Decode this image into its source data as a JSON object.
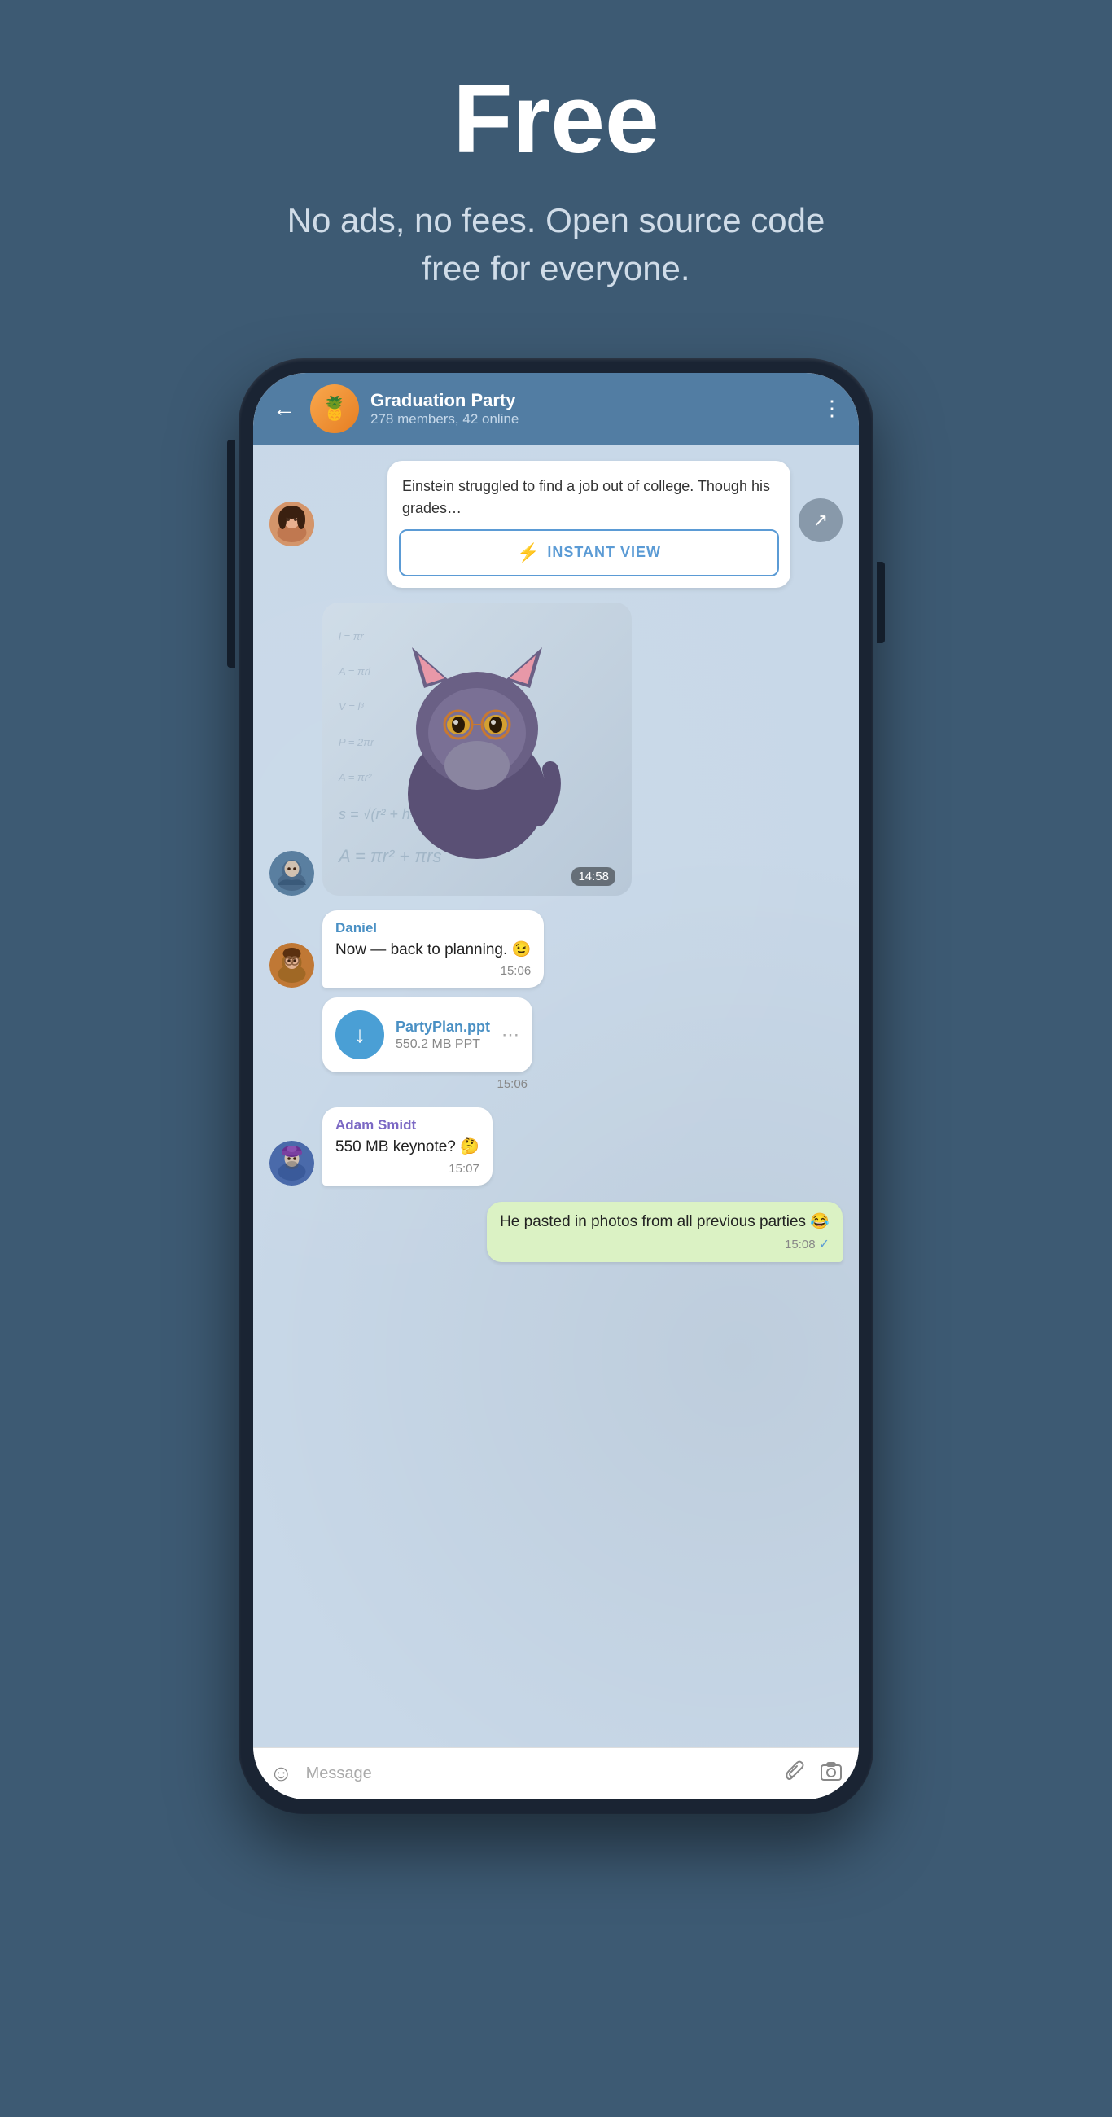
{
  "page": {
    "title": "Free",
    "subtitle": "No ads, no fees. Open source code free for everyone."
  },
  "chat": {
    "name": "Graduation Party",
    "status": "278 members, 42 online",
    "avatar_emoji": "🍍"
  },
  "messages": [
    {
      "id": "article",
      "type": "article",
      "text": "Einstein struggled to find a job out of college. Though his grades...",
      "instant_view_label": "INSTANT VIEW",
      "sender_avatar": "girl"
    },
    {
      "id": "sticker",
      "type": "sticker",
      "timestamp": "14:58",
      "sender": "boy"
    },
    {
      "id": "daniel-msg",
      "type": "text",
      "sender": "Daniel",
      "text": "Now — back to planning. 😉",
      "time": "15:06"
    },
    {
      "id": "file-msg",
      "type": "file",
      "filename": "PartyPlan.ppt",
      "filesize": "550.2 MB PPT",
      "time": "15:06"
    },
    {
      "id": "adam-msg",
      "type": "text",
      "sender": "Adam Smidt",
      "text": "550 MB keynote? 🤔",
      "time": "15:07"
    },
    {
      "id": "own-msg",
      "type": "own",
      "text": "He pasted in photos from all previous parties 😂",
      "time": "15:08"
    }
  ],
  "input": {
    "placeholder": "Message"
  },
  "icons": {
    "back": "←",
    "more": "⋮",
    "share": "↗",
    "lightning": "⚡",
    "download": "↓",
    "emoji": "☺",
    "attach": "🔗",
    "camera": "⊙",
    "check": "✓"
  },
  "colors": {
    "header_bg": "#527da3",
    "chat_bg": "#c8d8e8",
    "accent": "#4a90c4",
    "page_bg": "#3d5a73",
    "own_bubble": "#dbf2c4",
    "file_icon": "#4a9fd5"
  }
}
